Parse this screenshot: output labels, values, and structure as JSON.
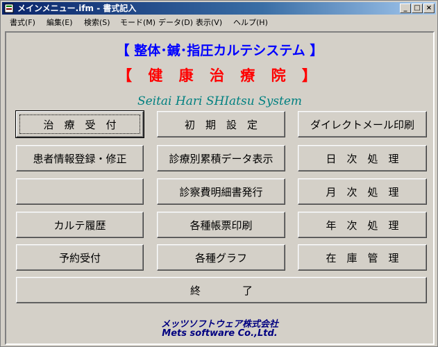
{
  "window": {
    "title": "メインメニュー.ifm - 書式記入"
  },
  "menu": [
    "書式(F)",
    "編集(E)",
    "検索(S)",
    "モード(M)",
    "データ(D)",
    "表示(V)",
    "ヘルプ(H)"
  ],
  "header": {
    "system_title": "【  整体･鍼･指圧カルテシステム  】",
    "clinic_name": "【 健 康 治 療 院 】",
    "english_title": "Seitai Hari SHIatsu System"
  },
  "buttons": {
    "reception": "治　療　受　付",
    "initial_settings": "初　期　設　定",
    "direct_mail": "ダイレクトメール印刷",
    "patient_registration": "患者情報登録・修正",
    "cumulative_data": "診療別累積データ表示",
    "daily_processing": "日　次　処　理",
    "blank": "",
    "medical_statement": "診察費明細書発行",
    "monthly_processing": "月　次　処　理",
    "karte_history": "カルテ履歴",
    "form_printing": "各種帳票印刷",
    "yearly_processing": "年　次　処　理",
    "appointment": "予約受付",
    "graphs": "各種グラフ",
    "inventory": "在　庫　管　理",
    "exit": "終　　　　了"
  },
  "footer": {
    "company_jp": "メッツソフトウェア株式会社",
    "company_en": "Mets software Co.,Ltd."
  },
  "colors": {
    "titlebar": "#0a246a",
    "system_title": "#0000ff",
    "clinic_name": "#ff0000",
    "english_title": "#008080",
    "footer": "#000080"
  }
}
